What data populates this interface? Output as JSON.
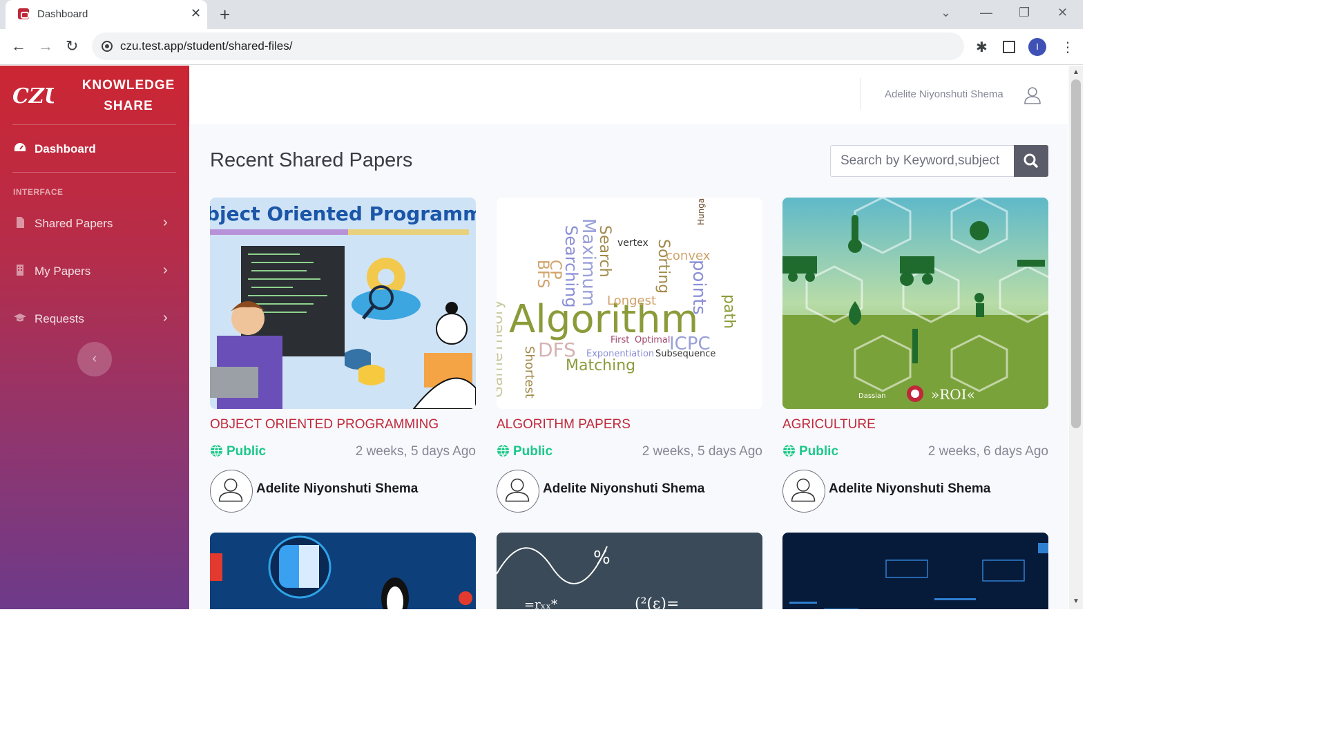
{
  "browser": {
    "tab_title": "Dashboard",
    "tab_close": "✕",
    "new_tab": "+",
    "url": "czu.test.app/student/shared-files/",
    "profile_initial": "I"
  },
  "sidebar": {
    "brand": "KNOWLEDGE SHARE",
    "brand_line1": "KNOWLEDGE",
    "brand_line2": "SHARE",
    "logo_text": "CZU",
    "dashboard_label": "Dashboard",
    "heading": "INTERFACE",
    "items": [
      {
        "label": "Shared Papers",
        "icon": "file-icon"
      },
      {
        "label": "My Papers",
        "icon": "building-icon"
      },
      {
        "label": "Requests",
        "icon": "graduation-cap-icon"
      }
    ],
    "toggle": "‹"
  },
  "topbar": {
    "user_name": "Adelite Niyonshuti Shema"
  },
  "main": {
    "title": "Recent Shared Papers",
    "search_placeholder": "Search by Keyword,subject"
  },
  "cards": [
    {
      "title": "OBJECT ORIENTED PROGRAMMING",
      "visibility": "Public",
      "date": "2 weeks, 5 days Ago",
      "author": "Adelite Niyonshuti Shema",
      "image_text": "bject Oriented Programming"
    },
    {
      "title": "ALGORITHM PAPERS",
      "visibility": "Public",
      "date": "2 weeks, 5 days Ago",
      "author": "Adelite Niyonshuti Shema",
      "image_text": "Algorithm"
    },
    {
      "title": "AGRICULTURE",
      "visibility": "Public",
      "date": "2 weeks, 6 days Ago",
      "author": "Adelite Niyonshuti Shema",
      "image_text": "»ROI«"
    }
  ],
  "colors": {
    "sidebar_top": "#cc2633",
    "sidebar_bottom": "#6d3a8a",
    "title_red": "#c0283a",
    "public_green": "#1cc88a",
    "search_button": "#5a5c69"
  }
}
